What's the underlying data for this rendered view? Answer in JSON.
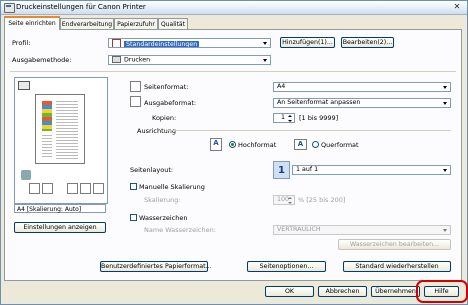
{
  "window": {
    "title": "Druckeinstellungen für Canon Printer",
    "close_glyph": "✕"
  },
  "tabs": [
    {
      "label": "Seite einrichten"
    },
    {
      "label": "Endverarbeitung"
    },
    {
      "label": "Papierzufuhr"
    },
    {
      "label": "Qualität"
    }
  ],
  "profile": {
    "label": "Profil:",
    "value": "Standardeinstellungen",
    "add_button": "Hinzufügen(1)...",
    "edit_button": "Bearbeiten(2)..."
  },
  "output_method": {
    "label": "Ausgabemethode:",
    "value": "Drucken"
  },
  "page_size": {
    "label": "Seitenformat:",
    "value": "A4"
  },
  "output_size": {
    "label": "Ausgabeformat:",
    "value": "An Seitenformat anpassen"
  },
  "copies": {
    "label": "Kopien:",
    "value": "1",
    "range": "[1 bis 9999]"
  },
  "orientation": {
    "label": "Ausrichtung",
    "portrait": "Hochformat",
    "landscape": "Querformat",
    "icon_letter": "A",
    "selected": "portrait"
  },
  "page_layout": {
    "label": "Seitenlayout:",
    "value": "1 auf 1",
    "icon_text": "1"
  },
  "manual_scaling": {
    "label": "Manuelle Skalierung",
    "field_label": "Skalierung:",
    "value": "100",
    "range": "% [25 bis 200]"
  },
  "watermark": {
    "label": "Wasserzeichen",
    "name_label": "Name Wasserzeichen:",
    "value": "VERTRAULICH",
    "edit_button": "Wasserzeichen bearbeiten..."
  },
  "preview": {
    "caption": "A4 [Skalierung: Auto]"
  },
  "settings_button": "Einstellungen anzeigen",
  "bottom_buttons": {
    "custom_paper": "Benutzerdefiniertes Papierformat...",
    "page_options": "Seitenoptionen...",
    "restore_defaults": "Standard wiederherstellen"
  },
  "dialog_buttons": {
    "ok": "OK",
    "cancel": "Abbrechen",
    "apply": "Übernehmen",
    "help": "Hilfe"
  },
  "colors": {
    "accent": "#e68b2c",
    "highlight": "#d40000"
  }
}
